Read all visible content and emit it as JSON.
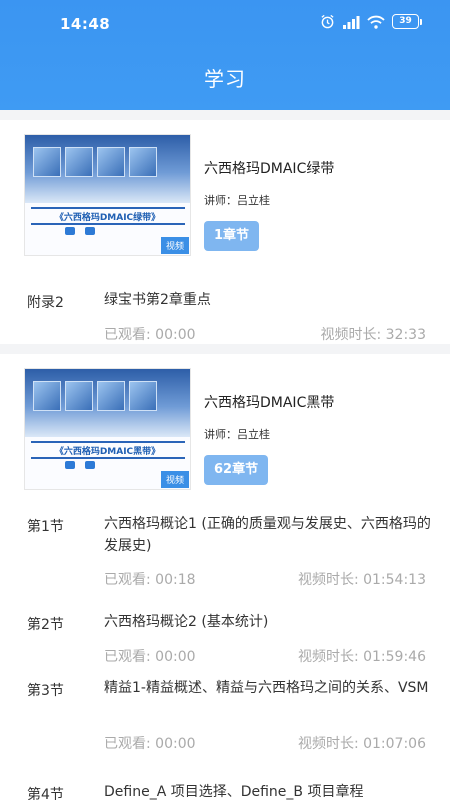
{
  "status_bar": {
    "time": "14:48",
    "battery": "39",
    "icons": [
      "alarm-icon",
      "signal-icon",
      "wifi-icon",
      "battery-icon"
    ]
  },
  "header": {
    "title": "学习"
  },
  "colors": {
    "header_blue": "#3b95f2",
    "badge_blue": "#7fb6f0",
    "muted_text": "#aaaaaa"
  },
  "courses": [
    {
      "name": "六西格玛DMAIC绿带",
      "teacher": "讲师：吕立桂",
      "chapters": "1章节",
      "thumb_tag": "视频",
      "thumb_text": "《六西格玛DMAIC绿带》",
      "lessons": [
        {
          "no": "附录2",
          "title": "绿宝书第2章重点",
          "watched": "已观看: 00:00",
          "duration": "视频时长: 32:33"
        }
      ]
    },
    {
      "name": "六西格玛DMAIC黑带",
      "teacher": "讲师：吕立桂",
      "chapters": "62章节",
      "thumb_tag": "视频",
      "thumb_text": "《六西格玛DMAIC黑带》",
      "lessons": [
        {
          "no": "第1节",
          "title": "六西格玛概论1 (正确的质量观与发展史、六西格玛的发展史)",
          "watched": "已观看: 00:18",
          "duration": "视频时长: 01:54:13"
        },
        {
          "no": "第2节",
          "title": "六西格玛概论2 (基本统计)",
          "watched": "已观看: 00:00",
          "duration": "视频时长: 01:59:46"
        },
        {
          "no": "第3节",
          "title": "精益1-精益概述、精益与六西格玛之间的关系、VSM",
          "watched": "已观看: 00:00",
          "duration": "视频时长: 01:07:06"
        },
        {
          "no": "第4节",
          "title": "Define_A 项目选择、Define_B 项目章程"
        }
      ]
    }
  ]
}
